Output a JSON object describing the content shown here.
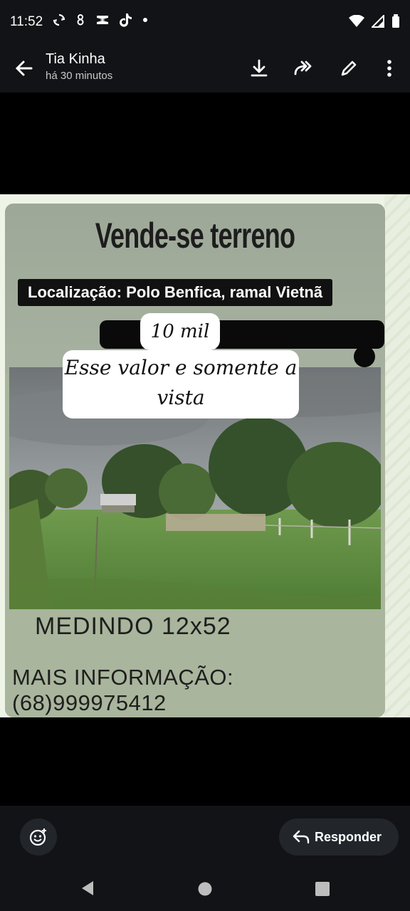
{
  "status_bar": {
    "time": "11:52"
  },
  "header": {
    "contact_name": "Tia Kinha",
    "subtitle": "há 30 minutos"
  },
  "poster": {
    "headline": "Vende-se terreno",
    "location": "Localização: Polo Benfica, ramal Vietnã",
    "price": "10 mil",
    "note": "Esse valor e somente a vista",
    "measure": "MEDINDO 12x52",
    "contact": "MAIS INFORMAÇÃO: (68)999975412"
  },
  "footer": {
    "reply_label": "Responder"
  },
  "colors": {
    "bar_bg": "#111316",
    "poster_green": "#a9b59c",
    "button_bg": "#22262b"
  }
}
